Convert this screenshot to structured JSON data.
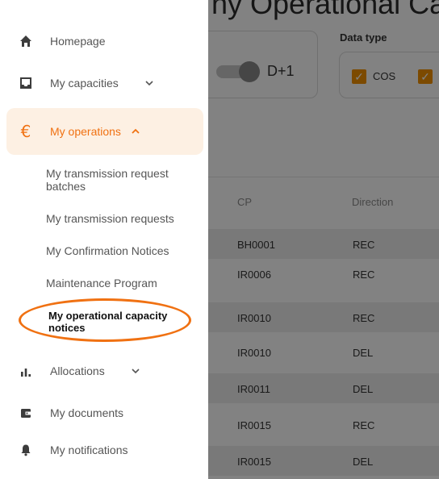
{
  "page": {
    "title_fragment": "ny Operational Cap",
    "period_toggle_label": "D+1",
    "data_type": {
      "label": "Data type",
      "options": [
        {
          "label": "COS",
          "checked": true
        },
        {
          "label": "",
          "checked": true
        }
      ]
    },
    "table": {
      "headers": {
        "cp": "CP",
        "direction": "Direction"
      },
      "rows": [
        {
          "cp": "BH0001",
          "direction": "REC"
        },
        {
          "cp": "IR0006",
          "direction": "REC"
        },
        {
          "cp": "IR0010",
          "direction": "REC"
        },
        {
          "cp": "IR0010",
          "direction": "DEL"
        },
        {
          "cp": "IR0011",
          "direction": "DEL"
        },
        {
          "cp": "IR0015",
          "direction": "REC"
        },
        {
          "cp": "IR0015",
          "direction": "DEL"
        }
      ]
    }
  },
  "sidebar": {
    "items": [
      {
        "label": "Homepage",
        "icon": "home-icon"
      },
      {
        "label": "My capacities",
        "icon": "inbox-icon"
      },
      {
        "label": "My operations",
        "icon": "euro-icon"
      },
      {
        "label": "Allocations",
        "icon": "bar-chart-icon"
      },
      {
        "label": "My documents",
        "icon": "wallet-icon"
      },
      {
        "label": "My notifications",
        "icon": "bell-icon"
      }
    ],
    "operations_sub": [
      {
        "label": "My transmission request batches"
      },
      {
        "label": "My transmission requests"
      },
      {
        "label": "My Confirmation Notices"
      },
      {
        "label": "Maintenance Program"
      },
      {
        "label": "My operational capacity notices"
      }
    ]
  },
  "colors": {
    "accent": "#f07112",
    "active_bg": "#fdf0e3",
    "checkbox": "#f39200"
  }
}
